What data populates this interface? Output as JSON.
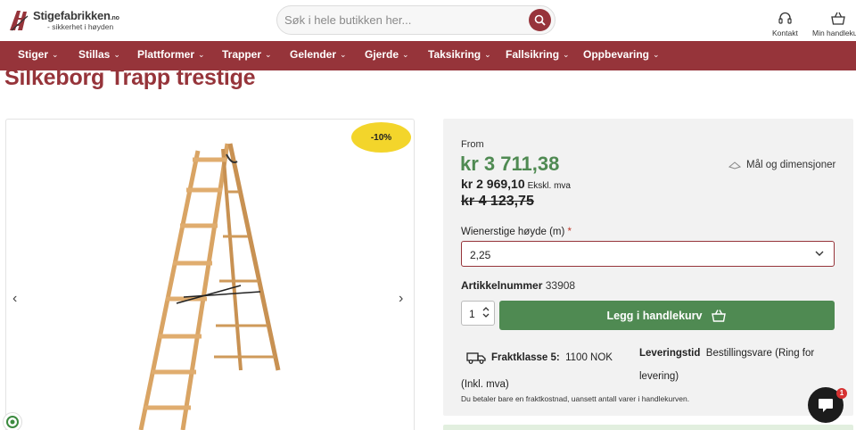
{
  "header": {
    "logo_name": "Stigefabrikken",
    "logo_tld": ".no",
    "logo_tagline": "- sikkerhet i høyden",
    "search_placeholder": "Søk i hele butikken her...",
    "contact_label": "Kontakt",
    "cart_label": "Min handlekurv"
  },
  "nav": {
    "items": [
      {
        "label": "Stiger"
      },
      {
        "label": "Stillas"
      },
      {
        "label": "Plattformer"
      },
      {
        "label": "Trapper"
      },
      {
        "label": "Gelender"
      },
      {
        "label": "Gjerde"
      },
      {
        "label": "Taksikring"
      },
      {
        "label": "Fallsikring"
      },
      {
        "label": "Oppbevaring"
      }
    ]
  },
  "product": {
    "title": "Silkeborg Trapp trestige",
    "discount_badge": "-10%",
    "from_label": "From",
    "price": "kr 3 711,38",
    "price_ex_vat": "kr 2 969,10",
    "price_ex_vat_suffix": "Ekskl. mva",
    "price_old": "kr 4 123,75",
    "dimensions_link": "Mål og dimensjoner",
    "variant_label": "Wienerstige høyde (m)",
    "variant_required_mark": "*",
    "variant_value": "2,25",
    "sku_label": "Artikkelnummer",
    "sku_value": "33908",
    "quantity": "1",
    "add_to_cart_label": "Legg i handlekurv",
    "freight_label": "Fraktklasse 5:",
    "freight_value": "1100 NOK (Inkl. mva)",
    "delivery_label": "Leveringstid",
    "delivery_value": "Bestillingsvare (Ring for levering)",
    "freight_note": "Du betaler bare en fraktkostnad, uansett antall varer i handlekurven."
  },
  "chat": {
    "badge_count": "1"
  },
  "colors": {
    "brand": "#96343a",
    "price_green": "#4f8a52",
    "badge_yellow": "#f3d52b",
    "panel_bg": "#f2f2f2"
  }
}
